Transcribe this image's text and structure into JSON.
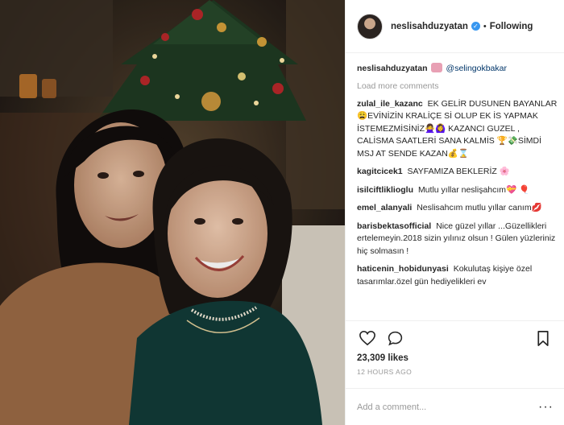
{
  "post": {
    "username": "neslisahduzyatan",
    "follow_label": "Following",
    "separator": "•"
  },
  "caption": {
    "username": "neslisahduzyatan",
    "mention": "@selingokbakar"
  },
  "load_more_label": "Load more comments",
  "comments": [
    {
      "user": "zulal_ile_kazanc",
      "text": "EK GELİR DUSUNEN BAYANLAR😩EVİNİZİN KRALİÇE Sİ OLUP EK İS YAPMAK İSTEMEZMİSİNİZ🙅‍♀️🙆‍♀️ KAZANCI GUZEL , CALİSMA SAATLERİ SANA KALMİS 🏆💸SİMDİ MSJ AT SENDE KAZAN💰⌛"
    },
    {
      "user": "kagitcicek1",
      "text": "SAYFAMIZA BEKLERİZ 🌸"
    },
    {
      "user": "isilciftliklioglu",
      "text": "Mutlu yıllar neslişahcım💝 🎈"
    },
    {
      "user": "emel_alanyali",
      "text": "Neslisahcım mutlu yıllar canım💋"
    },
    {
      "user": "barisbektasofficial",
      "text": "Nice güzel yıllar ...Güzellikleri ertelemeyin.2018 sizin yılınız olsun ! Gülen yüzleriniz hiç solmasın !"
    },
    {
      "user": "haticenin_hobidunyasi",
      "text": "Kokulutaş kişiye özel tasarımlar.özel gün hediyelikleri ev"
    }
  ],
  "likes_label": "23,309 likes",
  "time_label": "12 HOURS AGO",
  "add_comment": {
    "placeholder": "Add a comment...",
    "more_label": "···"
  },
  "colors": {
    "verified": "#3897f0",
    "muted": "#999999",
    "border": "#efefef",
    "mention": "#003569"
  },
  "icons": [
    "heart-icon",
    "comment-icon",
    "bookmark-icon",
    "verified-icon",
    "more-options-icon"
  ]
}
